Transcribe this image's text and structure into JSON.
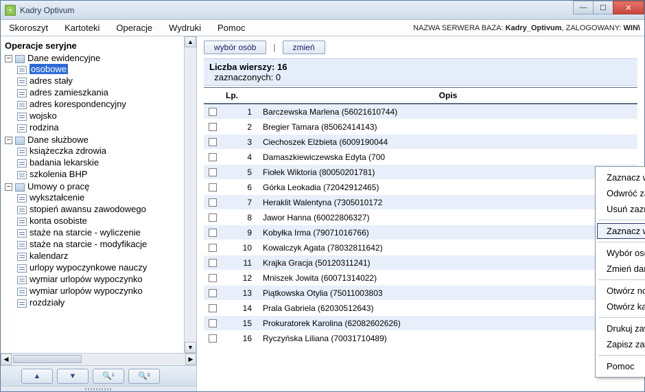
{
  "window": {
    "title": "Kadry Optivum"
  },
  "menubar": {
    "items": [
      "Skoroszyt",
      "Kartoteki",
      "Operacje",
      "Wydruki",
      "Pomoc"
    ],
    "server_prefix": "NAZWA SERWERA BAZA: ",
    "server_db": "Kadry_Optivum",
    "logged_prefix": ", ZALOGOWANY: ",
    "logged_user": "WIN\\"
  },
  "sidebar": {
    "title": "Operacje seryjne",
    "groups": [
      {
        "label": "Dane ewidencyjne",
        "items": [
          "osobowe",
          "adres stały",
          "adres zamieszkania",
          "adres korespondencyjny",
          "wojsko",
          "rodzina"
        ],
        "selected_index": 0
      },
      {
        "label": "Dane służbowe",
        "items": [
          "książeczka zdrowia",
          "badania lekarskie",
          "szkolenia BHP"
        ]
      },
      {
        "label": "Umowy o pracę",
        "items": [
          "wykształcenie",
          "stopień awansu zawodowego",
          "konta osobiste",
          "staże na starcie - wyliczenie",
          "staże na starcie - modyfikacje",
          "kalendarz",
          "urlopy wypoczynkowe nauczy",
          "wymiar urlopów wypoczynko",
          "wymiar urlopów wypoczynko",
          "rozdziały"
        ]
      }
    ]
  },
  "actions": {
    "select_people": "wybór osób",
    "change": "zmień"
  },
  "info": {
    "rows_label": "Liczba wierszy:",
    "rows_value": "16",
    "selected_label": "zaznaczonych:",
    "selected_value": "0"
  },
  "table": {
    "col_lp": "Lp.",
    "col_opis": "Opis",
    "rows": [
      {
        "lp": "1",
        "opis": "Barczewska Marlena (56021610744)"
      },
      {
        "lp": "2",
        "opis": "Bregier Tamara (85062414143)"
      },
      {
        "lp": "3",
        "opis": "Ciechoszek Elżbieta (6009190044"
      },
      {
        "lp": "4",
        "opis": "Damaszkiewiczewska Edyta (700"
      },
      {
        "lp": "5",
        "opis": "Fiołek Wiktoria (80050201781)"
      },
      {
        "lp": "6",
        "opis": "Górka Leokadia (72042912465)"
      },
      {
        "lp": "7",
        "opis": "Heraklit Walentyna (7305010172"
      },
      {
        "lp": "8",
        "opis": "Jawor Hanna (60022806327)"
      },
      {
        "lp": "9",
        "opis": "Kobyłka Irma (79071016766)"
      },
      {
        "lp": "10",
        "opis": "Kowalczyk Agata (78032811642)"
      },
      {
        "lp": "11",
        "opis": "Krajka Gracja (50120311241)"
      },
      {
        "lp": "12",
        "opis": "Mniszek Jowita (60071314022)"
      },
      {
        "lp": "13",
        "opis": "Piątkowska Otylia (75011003803"
      },
      {
        "lp": "14",
        "opis": "Prala Gabriela (62030512643)"
      },
      {
        "lp": "15",
        "opis": "Prokuratorek Karolina (62082602626)"
      },
      {
        "lp": "16",
        "opis": "Ryczyńska Liliana (70031710489)"
      }
    ]
  },
  "context_menu": {
    "items": [
      "Zaznacz wszystkie pozycje",
      "Odwróć zaznaczenia",
      "Usuń zaznaczenia",
      "—",
      "Zaznacz wybiórczo",
      "—",
      "Wybór osób",
      "Zmień dane",
      "—",
      "Otwórz notatnik",
      "Otwórz kalkulator okresów",
      "—",
      "Drukuj zawartość ekranu",
      "Zapisz zawartość ekranu w pliku",
      "—",
      "Pomoc"
    ],
    "highlight_index": 4
  }
}
